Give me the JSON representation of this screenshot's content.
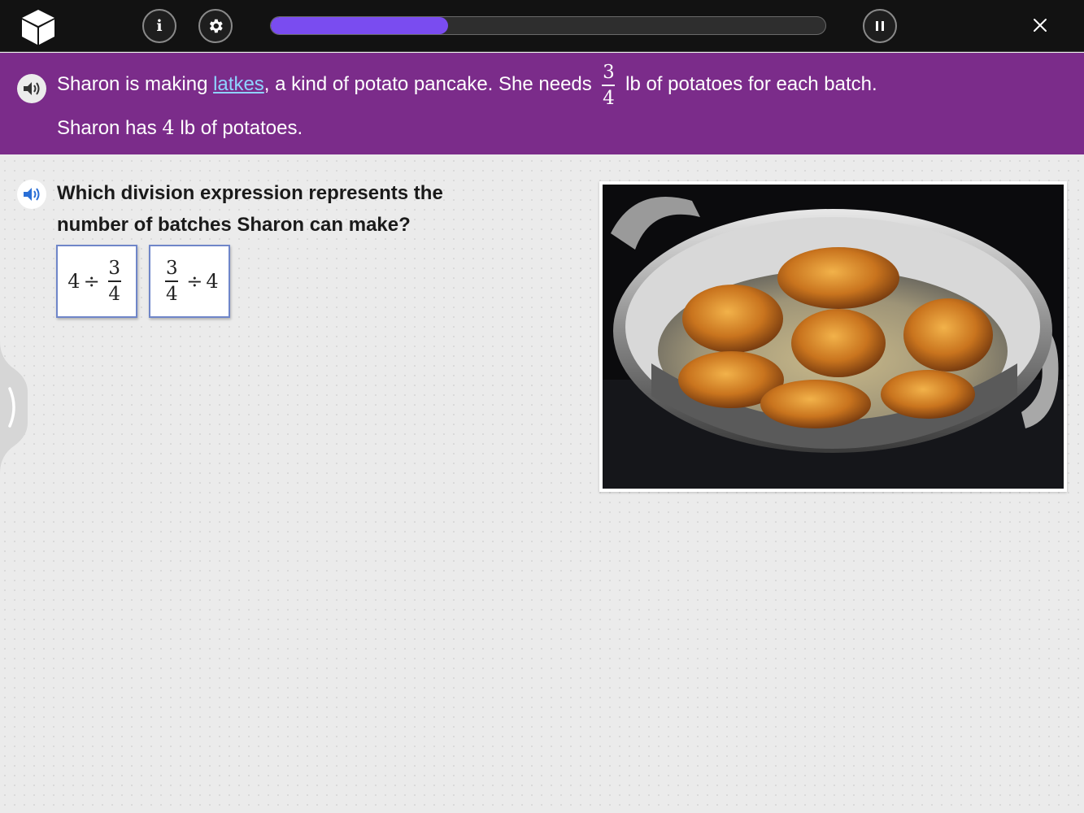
{
  "topbar": {
    "logo_icon": "cube-logo-icon",
    "info_label": "i",
    "progress_percent": 32,
    "progress_color": "#7a4cf0"
  },
  "banner": {
    "text_part1": "Sharon is making ",
    "link_text": "latkes",
    "text_part2": ", a kind of potato pancake. She needs ",
    "fraction_num": "3",
    "fraction_den": "4",
    "text_part3": " lb of potatoes for each batch.",
    "line2_part1": "Sharon has ",
    "line2_number": "4",
    "line2_part2": " lb of potatoes.",
    "bg_color": "#7b2c8a",
    "link_color": "#8fd3ff"
  },
  "question": {
    "text": "Which division expression represents the number of batches Sharon can make?"
  },
  "choices": [
    {
      "lead": "4",
      "op": "÷",
      "num": "3",
      "den": "4"
    },
    {
      "num": "3",
      "den": "4",
      "op": "÷",
      "trail": "4"
    }
  ],
  "accent_border": "#6f86c9"
}
